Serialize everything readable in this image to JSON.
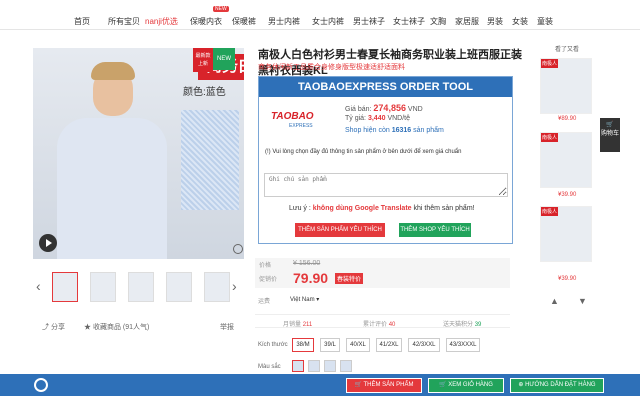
{
  "nav": {
    "items": [
      "首页",
      "所有宝贝",
      "nanji优选",
      "保暖内衣",
      "保暖裤",
      "男士内裤",
      "女士内裤",
      "男士袜子",
      "女士袜子",
      "文胸",
      "家居服",
      "男装",
      "女装",
      "童装"
    ],
    "badge": "NEW"
  },
  "product_image": {
    "banner": "商务白衬",
    "color_text": "颜色:蓝色",
    "new_badge": "NEW",
    "sale_badge": "最新款 上新"
  },
  "actions": {
    "share": "分享",
    "fav": "收藏商品",
    "fav_count": "(91人气)",
    "report": "举报"
  },
  "product": {
    "title": "南极人白色衬衫男士春夏长袖商务职业装上班西服正装黑衬衣西装KL",
    "subtitle": "商务休闲新工品质合身修身版型极速适舒适面料"
  },
  "tool": {
    "header": "TAOBAOEXPRESS ORDER TOOL",
    "logo": "TAOBAO",
    "logo_sub": "EXPRESS",
    "price_label": "Giá bán:",
    "price_value": "274,856",
    "price_unit": "VND",
    "rate_label": "Tỷ giá:",
    "rate_value": "3,440",
    "rate_unit": "VND/tệ",
    "shop_label": "Shop hiện còn",
    "shop_count": "16316",
    "shop_unit": "sản phẩm",
    "note": "(!) Vui lòng chọn đầy đủ thông tin sản phẩm ở bên dưới để xem giá chuẩn",
    "input_placeholder": "Ghi chú sản phẩm",
    "warn_prefix": "Lưu ý :",
    "warn_bold": "không dùng Google Translate",
    "warn_suffix": "khi thêm sản phẩm!",
    "btn_fav_product": "THÊM SẢN PHẨM YÊU THÍCH",
    "btn_fav_shop": "THÊM SHOP YÊU THÍCH"
  },
  "price": {
    "old_label": "价格",
    "old_value": "¥ 156.00",
    "new_label": "促销价",
    "new_value": "79.90",
    "tag": "春装特价"
  },
  "shipping": {
    "label": "运费",
    "value": "Việt Nam"
  },
  "stats": [
    {
      "label": "月销量",
      "value": "211"
    },
    {
      "label": "累计评价",
      "value": "40"
    },
    {
      "label": "送天猫积分",
      "value": "39"
    }
  ],
  "sizes": {
    "label": "Kích thước",
    "options": [
      "38/M",
      "39/L",
      "40/XL",
      "41/2XL",
      "42/3XXL",
      "43/3XXXL"
    ],
    "selected": 0
  },
  "colors": {
    "label": "Màu sắc"
  },
  "recommend": {
    "title": "看了又看",
    "items": [
      {
        "tag": "南极人",
        "price": "¥89.90"
      },
      {
        "tag": "南极人",
        "price": "¥39.90"
      },
      {
        "tag": "南极人",
        "price": "¥39.90"
      }
    ],
    "cart": "购物车"
  },
  "bottom": {
    "add": "THÊM SẢN PHẨM",
    "cart": "XEM GIỎ HÀNG",
    "guide": "HƯỚNG DẪN ĐẶT HÀNG"
  },
  "colors_theme": {
    "accent": "#e4393c",
    "blue": "#2e70b8",
    "green": "#21a35b"
  }
}
